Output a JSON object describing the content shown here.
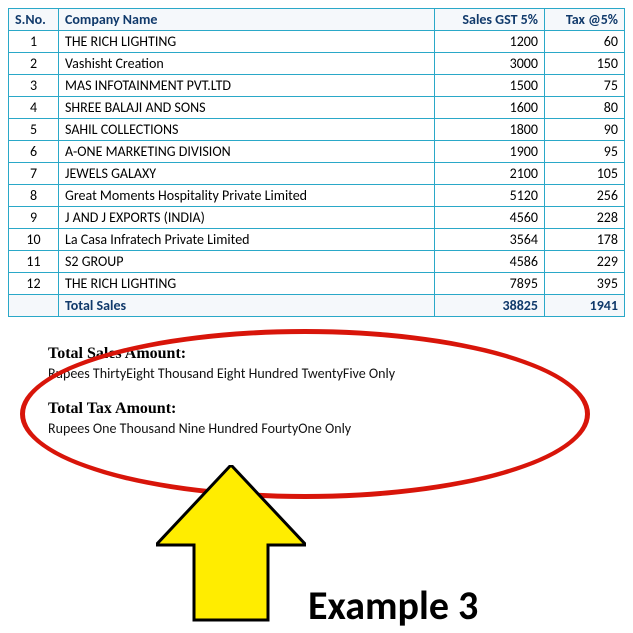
{
  "table": {
    "headers": {
      "sno": "S.No.",
      "company": "Company Name",
      "sales": "Sales GST 5%",
      "tax": "Tax @5%"
    },
    "rows": [
      {
        "sno": "1",
        "company": "THE RICH LIGHTING",
        "sales": "1200",
        "tax": "60"
      },
      {
        "sno": "2",
        "company": "Vashisht Creation",
        "sales": "3000",
        "tax": "150"
      },
      {
        "sno": "3",
        "company": "MAS INFOTAINMENT PVT.LTD",
        "sales": "1500",
        "tax": "75"
      },
      {
        "sno": "4",
        "company": "SHREE BALAJI AND SONS",
        "sales": "1600",
        "tax": "80"
      },
      {
        "sno": "5",
        "company": "SAHIL COLLECTIONS",
        "sales": "1800",
        "tax": "90"
      },
      {
        "sno": "6",
        "company": "A-ONE MARKETING DIVISION",
        "sales": "1900",
        "tax": "95"
      },
      {
        "sno": "7",
        "company": "JEWELS GALAXY",
        "sales": "2100",
        "tax": "105"
      },
      {
        "sno": "8",
        "company": "Great Moments Hospitality Private Limited",
        "sales": "5120",
        "tax": "256"
      },
      {
        "sno": "9",
        "company": "J AND J EXPORTS (INDIA)",
        "sales": "4560",
        "tax": "228"
      },
      {
        "sno": "10",
        "company": "La Casa Infratech Private Limited",
        "sales": "3564",
        "tax": "178"
      },
      {
        "sno": "11",
        "company": "S2 GROUP",
        "sales": "4586",
        "tax": "229"
      },
      {
        "sno": "12",
        "company": "THE RICH LIGHTING",
        "sales": "7895",
        "tax": "395"
      }
    ],
    "total": {
      "label": "Total Sales",
      "sales": "38825",
      "tax": "1941"
    }
  },
  "summary": {
    "sales_title": "Total Sales Amount:",
    "sales_words": "Rupees ThirtyEight Thousand Eight Hundred TwentyFive Only",
    "tax_title": "Total Tax Amount:",
    "tax_words": "Rupees One Thousand Nine Hundred FourtyOne Only"
  },
  "annotation": {
    "label": "Example 3",
    "ellipse_color": "#d8150a",
    "arrow_color": "#ffed00",
    "arrow_stroke": "#000000"
  },
  "chart_data": {
    "type": "table",
    "title": "Sales GST 5% and Tax @5% by Company",
    "columns": [
      "S.No.",
      "Company Name",
      "Sales GST 5%",
      "Tax @5%"
    ],
    "rows": [
      [
        1,
        "THE RICH LIGHTING",
        1200,
        60
      ],
      [
        2,
        "Vashisht Creation",
        3000,
        150
      ],
      [
        3,
        "MAS INFOTAINMENT PVT.LTD",
        1500,
        75
      ],
      [
        4,
        "SHREE BALAJI AND SONS",
        1600,
        80
      ],
      [
        5,
        "SAHIL COLLECTIONS",
        1800,
        90
      ],
      [
        6,
        "A-ONE MARKETING DIVISION",
        1900,
        95
      ],
      [
        7,
        "JEWELS GALAXY",
        2100,
        105
      ],
      [
        8,
        "Great Moments Hospitality Private Limited",
        5120,
        256
      ],
      [
        9,
        "J AND J EXPORTS (INDIA)",
        4560,
        228
      ],
      [
        10,
        "La Casa Infratech Private Limited",
        3564,
        178
      ],
      [
        11,
        "S2 GROUP",
        4586,
        229
      ],
      [
        12,
        "THE RICH LIGHTING",
        7895,
        395
      ]
    ],
    "totals": {
      "Sales GST 5%": 38825,
      "Tax @5%": 1941
    }
  }
}
